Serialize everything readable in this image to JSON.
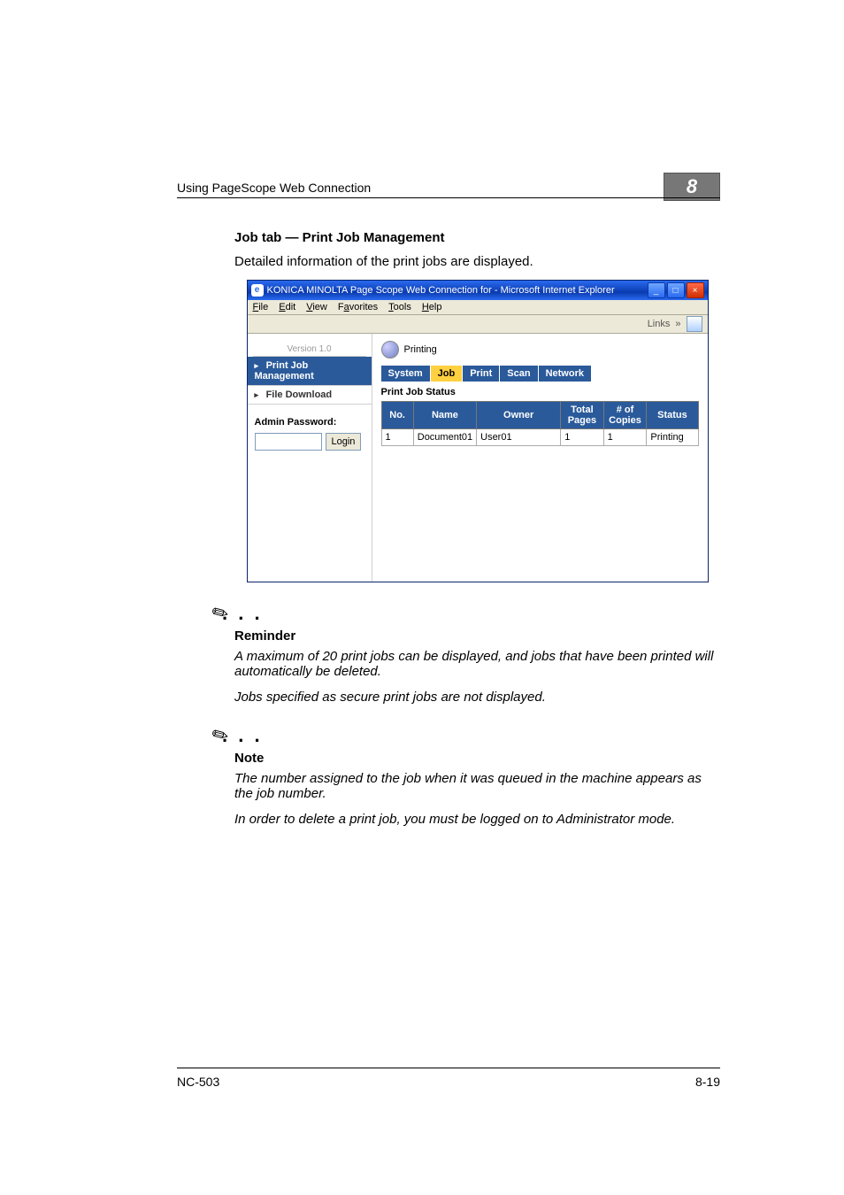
{
  "header": {
    "crumb": "Using PageScope Web Connection",
    "chapter": "8"
  },
  "body": {
    "section_title": "Job tab — Print Job Management",
    "intro": "Detailed information of the print jobs are displayed."
  },
  "reminder": {
    "label": "Reminder",
    "p1": "A maximum of 20 print jobs can be displayed, and jobs that have been printed will automatically be deleted.",
    "p2": "Jobs specified as secure print jobs are not displayed."
  },
  "note": {
    "label": "Note",
    "p1": "The number assigned to the job when it was queued in the machine appears as the job number.",
    "p2": "In order to delete a print job, you must be logged on to Administrator mode."
  },
  "footer": {
    "left": "NC-503",
    "right": "8-19"
  },
  "screenshot": {
    "title": "KONICA MINOLTA Page Scope Web Connection for          - Microsoft Internet Explorer",
    "menus": {
      "file": "File",
      "edit": "Edit",
      "view": "View",
      "favorites": "Favorites",
      "tools": "Tools",
      "help": "Help"
    },
    "links_label": "Links",
    "sidebar": {
      "version": "Version 1.0",
      "items": {
        "print_job_mgmt": "Print Job Management",
        "file_download": "File Download"
      },
      "admin_label": "Admin Password:",
      "login_label": "Login"
    },
    "main": {
      "status_label": "Printing",
      "tabs": {
        "system": "System",
        "job": "Job",
        "print": "Print",
        "scan": "Scan",
        "network": "Network"
      },
      "panel_title": "Print Job Status",
      "table": {
        "headers": {
          "no": "No.",
          "name": "Name",
          "owner": "Owner",
          "total_pages": "Total Pages",
          "copies": "# of Copies",
          "status": "Status"
        },
        "row1": {
          "no": "1",
          "name": "Document01",
          "owner": "User01",
          "total_pages": "1",
          "copies": "1",
          "status": "Printing"
        }
      }
    }
  }
}
